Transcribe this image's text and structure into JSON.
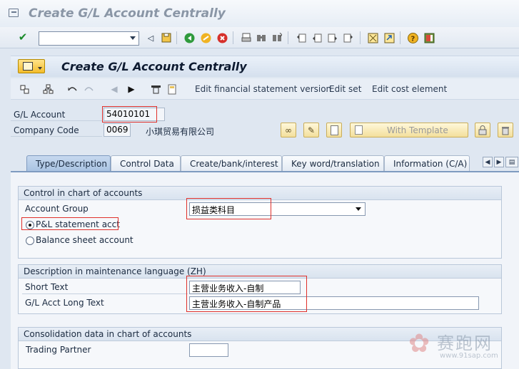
{
  "window": {
    "title": "Create G/L Account Centrally"
  },
  "toolbar": {
    "command_field": "",
    "icons": [
      "enter-icon",
      "back-arrow-icon",
      "save-icon",
      "back-icon",
      "exit-icon",
      "cancel-icon",
      "print-icon",
      "find-icon",
      "find-next-icon",
      "first-page-icon",
      "prev-page-icon",
      "next-page-icon",
      "last-page-icon",
      "create-session-icon",
      "shortcut-icon",
      "help-icon",
      "customize-layout-icon"
    ]
  },
  "transaction": {
    "title": "Create G/L Account Centrally"
  },
  "app_toolbar": {
    "buttons": [
      "Edit financial statement version",
      "Edit set",
      "Edit cost element"
    ]
  },
  "header": {
    "gl_account_label": "G/L Account",
    "gl_account_value": "54010101",
    "company_code_label": "Company Code",
    "company_code_value": "0069",
    "company_name": "小琪贸易有限公司",
    "template_button": "With Template"
  },
  "tabs": [
    {
      "label": "Type/Description",
      "active": true
    },
    {
      "label": "Control Data",
      "active": false
    },
    {
      "label": "Create/bank/interest",
      "active": false
    },
    {
      "label": "Key word/translation",
      "active": false
    },
    {
      "label": "Information (C/A)",
      "active": false
    }
  ],
  "group_control": {
    "title": "Control in chart of accounts",
    "account_group_label": "Account Group",
    "account_group_value": "损益类科目",
    "radio_pl_label": "P&L statement acct",
    "radio_pl_selected": true,
    "radio_bs_label": "Balance sheet account",
    "radio_bs_selected": false
  },
  "group_description": {
    "title": "Description in maintenance language (ZH)",
    "short_text_label": "Short Text",
    "short_text_value": "主营业务收入-自制",
    "long_text_label": "G/L Acct Long Text",
    "long_text_value": "主营业务收入-自制产品"
  },
  "group_consolidation": {
    "title": "Consolidation data in chart of accounts",
    "trading_partner_label": "Trading Partner",
    "trading_partner_value": ""
  },
  "watermark": {
    "text": "赛跑网",
    "url": "www.91sap.com"
  },
  "colors": {
    "highlight": "#e0302b",
    "active_tab": "#a9c3e2",
    "button": "#f4bd2b"
  }
}
